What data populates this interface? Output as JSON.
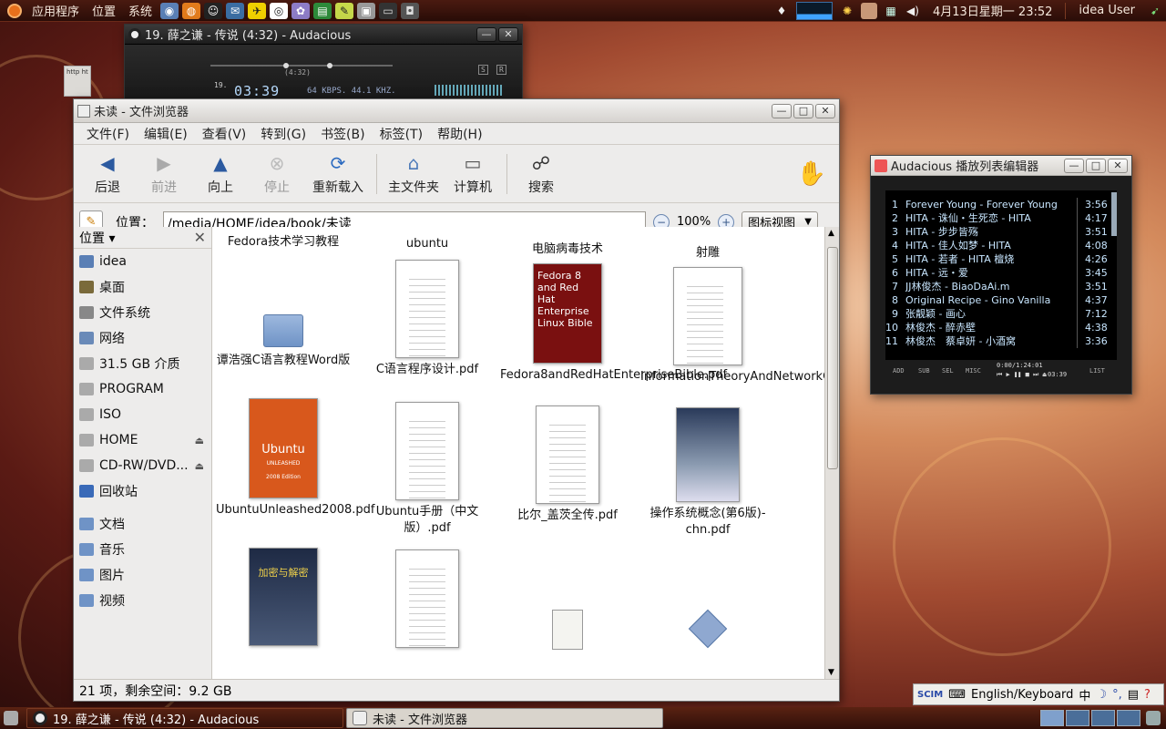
{
  "top_panel": {
    "menus": [
      "应用程序",
      "位置",
      "系统"
    ],
    "datetime": "4月13日星期一 23:52",
    "user": "idea User"
  },
  "desktop": {
    "ghost_icon_text": "http\nht"
  },
  "audacious_main": {
    "title": "19. 薛之谦 - 传说 (4:32) - Audacious",
    "time": "03:39",
    "track_no": "19.",
    "bitrate_info": "64 KBPS. 44.1 KHZ.",
    "position_label": "(4:32)"
  },
  "playlist": {
    "title": "Audacious 播放列表编辑器",
    "items": [
      {
        "num": "1",
        "title": "Forever Young - Forever Young",
        "time": "3:56"
      },
      {
        "num": "2",
        "title": "HITA - 诛仙・生死恋 - HITA",
        "time": "4:17"
      },
      {
        "num": "3",
        "title": "HITA - 步步皆殇",
        "time": "3:51"
      },
      {
        "num": "4",
        "title": "HITA - 佳人如梦 - HITA",
        "time": "4:08"
      },
      {
        "num": "5",
        "title": "HITA - 若者 - HITA 檀烧",
        "time": "4:26"
      },
      {
        "num": "6",
        "title": "HITA - 远・爱",
        "time": "3:45"
      },
      {
        "num": "7",
        "title": "JJ林俊杰 - BiaoDaAi.m",
        "time": "3:51"
      },
      {
        "num": "8",
        "title": "Original Recipe - Gino Vanilla",
        "time": "4:37"
      },
      {
        "num": "9",
        "title": "张靓颖 - 画心",
        "time": "7:12"
      },
      {
        "num": "10",
        "title": "林俊杰 - 醉赤壁",
        "time": "4:38"
      },
      {
        "num": "11",
        "title": "林俊杰　蔡卓妍 - 小酒窝",
        "time": "3:36"
      }
    ],
    "footer": {
      "add": "ADD",
      "sub": "SUB",
      "sel": "SEL",
      "misc": "MISC",
      "list": "LIST",
      "total": "0:00/1:24:01",
      "current": "03:39"
    }
  },
  "file_browser": {
    "title": "未读 - 文件浏览器",
    "title_short": "未读",
    "title_app": "文件浏览器",
    "menus": [
      "文件(F)",
      "编辑(E)",
      "查看(V)",
      "转到(G)",
      "书签(B)",
      "标签(T)",
      "帮助(H)"
    ],
    "toolbar": {
      "back": "后退",
      "forward": "前进",
      "up": "向上",
      "stop": "停止",
      "reload": "重新载入",
      "home": "主文件夹",
      "computer": "计算机",
      "search": "搜索"
    },
    "location_label": "位置：",
    "location_path": "/media/HOME/idea/book/未读",
    "zoom": "100%",
    "view_mode": "图标视图",
    "sidebar": {
      "header": "位置",
      "places": [
        "idea",
        "桌面",
        "文件系统",
        "网络",
        "31.5 GB 介质",
        "PROGRAM",
        "ISO",
        "HOME",
        "CD-RW/DVD...",
        "回收站"
      ],
      "bookmarks": [
        "文档",
        "音乐",
        "图片",
        "视频"
      ]
    },
    "files": {
      "r0": [
        "Fedora技术学习教程",
        "ubuntu",
        "电脑病毒技术",
        "射雕"
      ],
      "r1": [
        "谭浩强C语言教程Word版",
        "C语言程序设计.pdf",
        "Fedora8andRedHatEnterpriseBible.pdf",
        "InformationTheoryAndNetworkCoding.pdf"
      ],
      "r2": [
        "UbuntuUnleashed2008.pdf",
        "Ubuntu手册（中文版）.pdf",
        "比尔_盖茨全传.pdf",
        "操作系统概念(第6版)-chn.pdf"
      ],
      "book_covers": {
        "fedora": "Fedora 8 and Red Hat Enterprise Linux Bible",
        "ubuntu": "Ubuntu",
        "ubuntu_sub": "UNLEASHED",
        "ubuntu_edition": "2008 Edition",
        "crypto": "加密与解密"
      }
    },
    "status": "21 项，剩余空间：9.2 GB"
  },
  "taskbar": {
    "items": [
      "19. 薛之谦 - 传说 (4:32) - Audacious",
      "未读 - 文件浏览器"
    ]
  },
  "ime": {
    "label": "English/Keyboard",
    "mode": "中"
  }
}
